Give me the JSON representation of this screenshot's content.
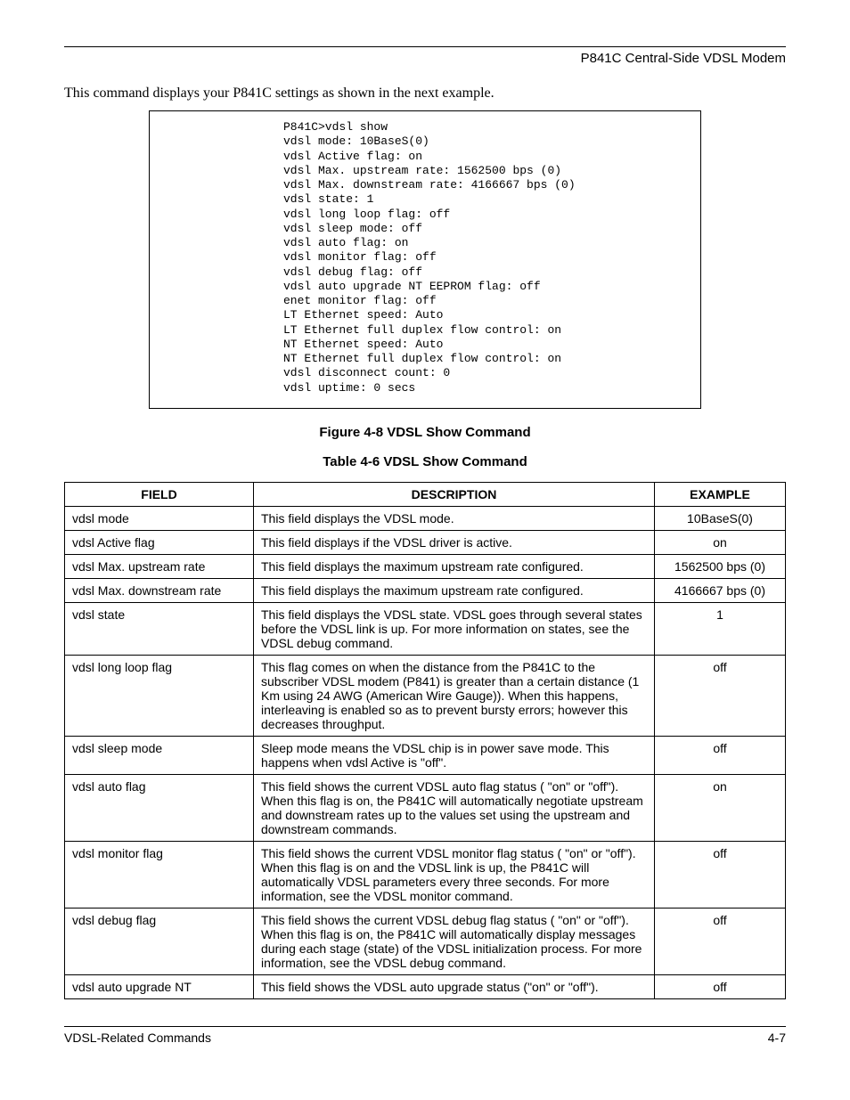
{
  "header": {
    "title": "P841C Central-Side VDSL Modem"
  },
  "intro": "This command displays your P841C settings as shown in the next example.",
  "terminal": "P841C>vdsl show\nvdsl mode: 10BaseS(0)\nvdsl Active flag: on\nvdsl Max. upstream rate: 1562500 bps (0)\nvdsl Max. downstream rate: 4166667 bps (0)\nvdsl state: 1\nvdsl long loop flag: off\nvdsl sleep mode: off\nvdsl auto flag: on\nvdsl monitor flag: off\nvdsl debug flag: off\nvdsl auto upgrade NT EEPROM flag: off\nenet monitor flag: off\nLT Ethernet speed: Auto\nLT Ethernet full duplex flow control: on\nNT Ethernet speed: Auto\nNT Ethernet full duplex flow control: on\nvdsl disconnect count: 0\nvdsl uptime: 0 secs",
  "figure_caption": "Figure 4-8 VDSL Show Command",
  "table_caption": "Table 4-6 VDSL Show Command",
  "table": {
    "headers": {
      "field": "FIELD",
      "description": "DESCRIPTION",
      "example": "EXAMPLE"
    },
    "rows": [
      {
        "field": "vdsl mode",
        "description": "This field displays the VDSL mode.",
        "example": "10BaseS(0)"
      },
      {
        "field": "vdsl Active flag",
        "description": "This field displays if the VDSL driver is active.",
        "example": "on"
      },
      {
        "field": "vdsl Max. upstream rate",
        "description": "This field displays the maximum upstream rate configured.",
        "example": "1562500 bps (0)"
      },
      {
        "field": "vdsl Max. downstream rate",
        "description": "This field displays the maximum upstream rate configured.",
        "example": "4166667 bps (0)"
      },
      {
        "field": "vdsl state",
        "description": "This field displays the VDSL state. VDSL goes through several states before the VDSL link is up. For more information on states, see the VDSL debug command.",
        "example": "1"
      },
      {
        "field": "vdsl long loop flag",
        "description": "This flag comes on when the distance from the P841C to the subscriber VDSL modem (P841) is greater than a certain distance (1 Km using 24 AWG (American Wire Gauge)). When this happens, interleaving is enabled so as to prevent bursty errors; however this decreases throughput.",
        "example": "off"
      },
      {
        "field": "vdsl sleep mode",
        "description": "Sleep mode means the VDSL chip is in power save mode. This happens when vdsl Active is \"off\".",
        "example": "off"
      },
      {
        "field": "vdsl auto flag",
        "description": "This field shows the current VDSL auto flag status ( \"on\" or \"off\"). When this flag is on, the P841C will automatically negotiate upstream and downstream rates up to the values set using the upstream and downstream commands.",
        "example": "on"
      },
      {
        "field": "vdsl monitor flag",
        "description": "This field shows the current VDSL monitor flag status ( \"on\" or \"off\"). When this flag is on and the VDSL link is up, the P841C will automatically VDSL parameters every three seconds. For more information, see the VDSL monitor command.",
        "example": "off"
      },
      {
        "field": "vdsl debug flag",
        "description": "This field shows the current VDSL debug flag status ( \"on\" or \"off\"). When this flag is on, the P841C will automatically display messages during each stage (state) of the VDSL initialization process. For more information, see the VDSL debug command.",
        "example": "off"
      },
      {
        "field": "vdsl auto upgrade NT",
        "description": "This field shows the VDSL auto upgrade status (\"on\" or \"off\").",
        "example": "off"
      }
    ]
  },
  "footer": {
    "left": "VDSL-Related Commands",
    "right": "4-7"
  }
}
